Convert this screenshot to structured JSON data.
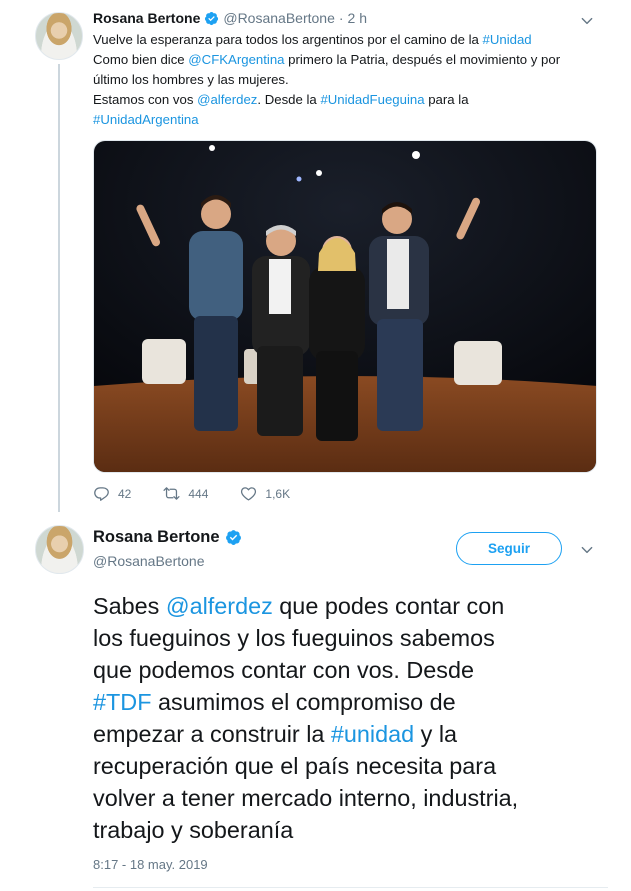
{
  "reply_tweet": {
    "author_name": "Rosana Bertone",
    "author_handle": "@RosanaBertone",
    "separator": "·",
    "time": "2 h",
    "lines": [
      [
        {
          "t": "Vuelve la esperanza para todos los argentinos por el camino de la "
        },
        {
          "t": "#Unidad",
          "link": true
        }
      ],
      [
        {
          "t": "Como bien dice "
        },
        {
          "t": "@CFKArgentina",
          "link": true
        },
        {
          "t": " primero la Patria, después el movimiento y por"
        }
      ],
      [
        {
          "t": "último los hombres y las mujeres."
        }
      ],
      [
        {
          "t": "Estamos con vos "
        },
        {
          "t": "@alferdez",
          "link": true
        },
        {
          "t": ". Desde la "
        },
        {
          "t": "#UnidadFueguina",
          "link": true
        },
        {
          "t": " para la"
        }
      ],
      [
        {
          "t": "#UnidadArgentina",
          "link": true
        }
      ]
    ],
    "actions": {
      "replies": "42",
      "retweets": "444",
      "likes": "1,6K"
    }
  },
  "main_tweet": {
    "author_name": "Rosana Bertone",
    "author_handle": "@RosanaBertone",
    "follow_label": "Seguir",
    "lines": [
      [
        {
          "t": "Sabes "
        },
        {
          "t": "@alferdez",
          "link": true
        },
        {
          "t": " que podes contar con"
        }
      ],
      [
        {
          "t": "los fueguinos y los fueguinos sabemos"
        }
      ],
      [
        {
          "t": "que podemos contar con vos. Desde"
        }
      ],
      [
        {
          "t": "#TDF",
          "link": true
        },
        {
          "t": " asumimos el compromiso de"
        }
      ],
      [
        {
          "t": "empezar a construir la "
        },
        {
          "t": "#unidad",
          "link": true
        },
        {
          "t": " y la"
        }
      ],
      [
        {
          "t": "recuperación que el país necesita para"
        }
      ],
      [
        {
          "t": "volver a tener mercado interno, industria,"
        }
      ],
      [
        {
          "t": "trabajo y soberanía"
        }
      ]
    ],
    "timestamp": "8:17 - 18 may. 2019"
  },
  "icons": {
    "verified": "verified-badge-icon",
    "caret": "chevron-down-icon",
    "reply": "reply-icon",
    "retweet": "retweet-icon",
    "like": "heart-icon"
  },
  "colors": {
    "link": "#1b95e0",
    "accent": "#1da1f2",
    "muted_text": "#657786",
    "primary_text": "#14171a"
  }
}
